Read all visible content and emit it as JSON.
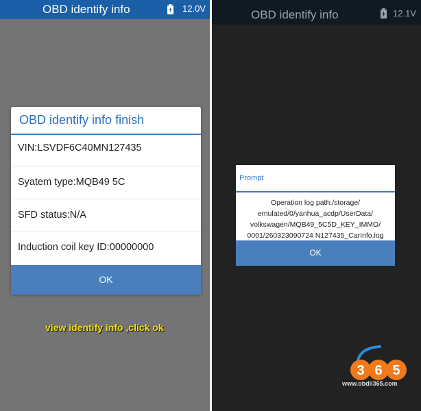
{
  "left": {
    "header": {
      "title": "OBD identify info",
      "voltage": "12.0V"
    },
    "dialog": {
      "title": "OBD identify info finish",
      "rows": [
        "VIN:LSVDF6C40MN127435",
        "Syatem type:MQB49 5C",
        "SFD status:N/A",
        "Induction coil key ID:00000000"
      ],
      "ok_label": "OK"
    },
    "caption": "view identify info ,click ok"
  },
  "right": {
    "header": {
      "title": "OBD identify info",
      "voltage": "12.1V"
    },
    "dialog": {
      "title": "Prompt",
      "message_lines": [
        "Operation log path:/storage/",
        "emulated/0/yanhua_acdp/UserData/",
        "volkswagen/MQB49_5C5D_KEY_IMMO/",
        "0001/260323090724 N127435_CarInfo.log"
      ],
      "ok_label": "OK"
    }
  },
  "watermark": {
    "logo_text": "365",
    "url": "www.obdii365.com"
  },
  "colors": {
    "header_blue": "#1a5fa7",
    "button_blue": "#4a7fbd",
    "title_blue": "#2d6fbf",
    "caption_yellow": "#f5e100"
  },
  "icons": {
    "battery": "battery-charging-icon"
  }
}
